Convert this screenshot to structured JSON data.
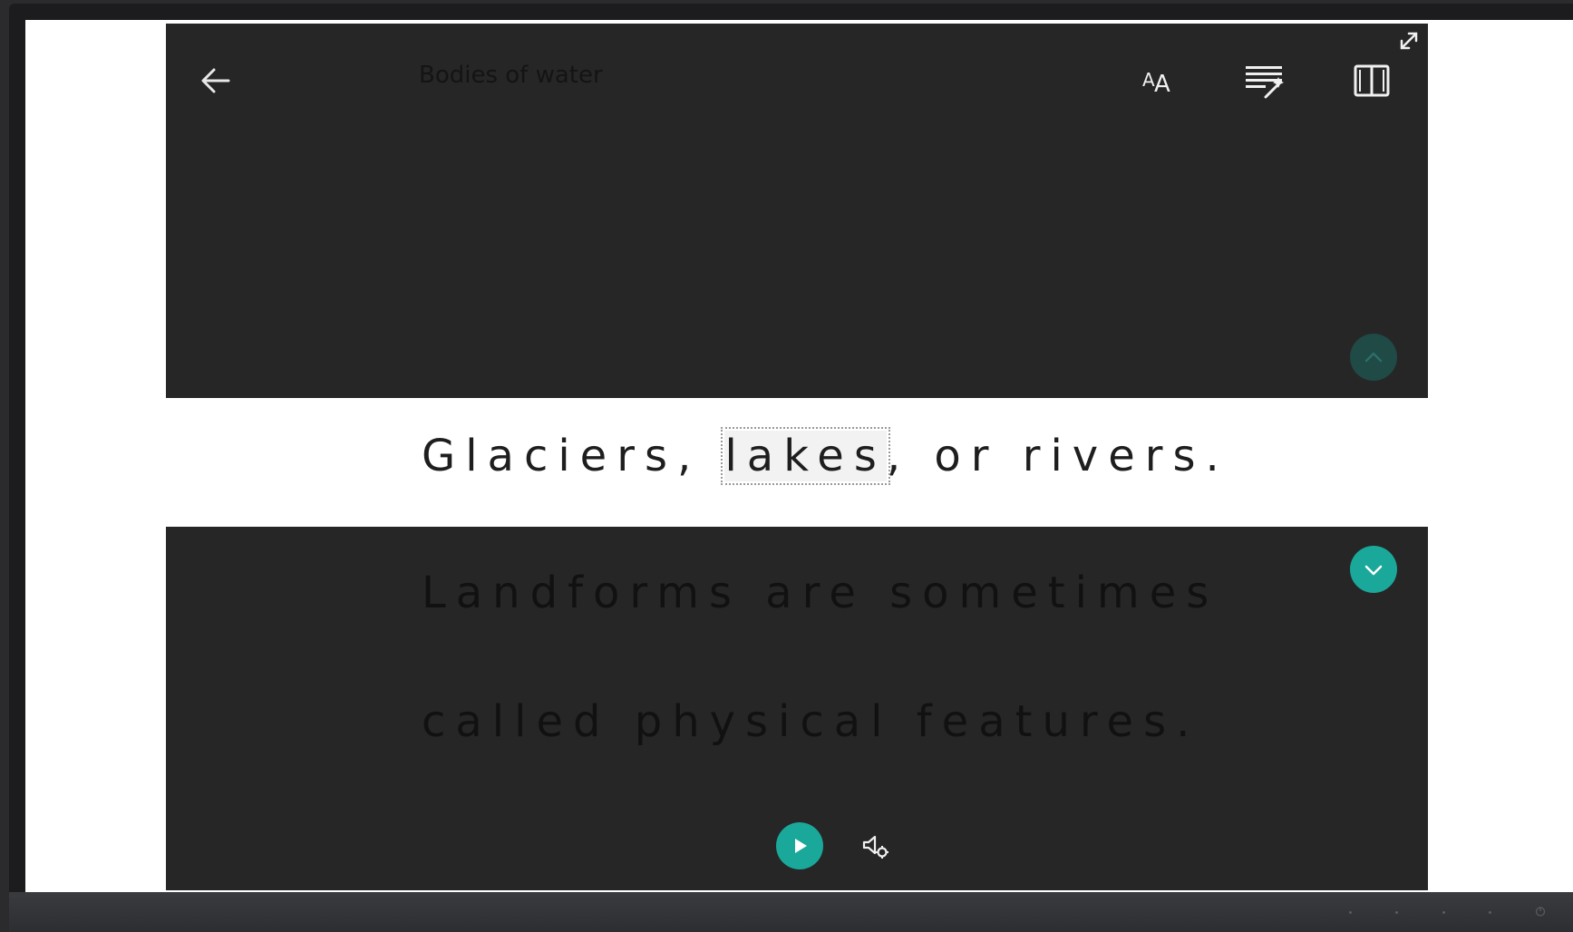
{
  "reader": {
    "title": "Bodies of water",
    "focus_line": {
      "before": "Glaciers, ",
      "highlighted_word": "lakes",
      "after": ", or rivers."
    },
    "next_lines": [
      "Landforms are sometimes",
      "called physical features."
    ]
  },
  "icons": {
    "back": "arrow-left-icon",
    "text_preferences": "text-size-icon",
    "grammar_options": "grammar-options-icon",
    "reading_preferences": "book-icon",
    "expand": "expand-icon",
    "previous_line": "chevron-up-icon",
    "next_line": "chevron-down-icon",
    "play": "play-icon",
    "voice_settings": "voice-settings-icon"
  },
  "colors": {
    "accent": "#1aa89a",
    "accent_dim": "#1f4a46",
    "background": "#262626",
    "focus_strip": "#ffffff"
  }
}
